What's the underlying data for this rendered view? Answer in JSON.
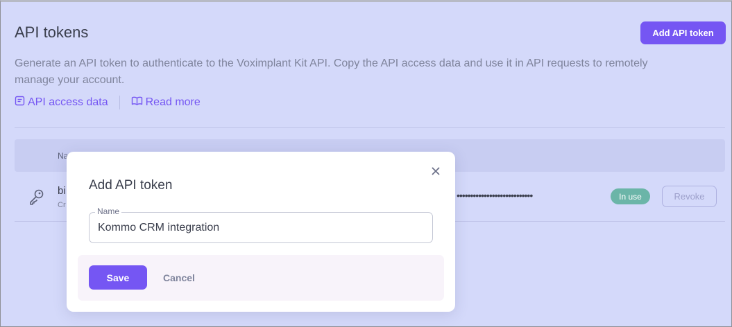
{
  "page": {
    "title": "API tokens",
    "add_button_label": "Add API token",
    "description": "Generate an API token to authenticate to the Voximplant Kit API. Copy the API access data and use it in API requests to remotely manage your account.",
    "links": [
      {
        "label": "API access data",
        "icon": "document-icon"
      },
      {
        "label": "Read more",
        "icon": "book-icon"
      }
    ]
  },
  "table": {
    "header_name": "Na",
    "row": {
      "name": "bi",
      "sub": "Cr",
      "masked_token": "••••••••••••••••••••••••••••",
      "status": "In use",
      "revoke_label": "Revoke",
      "icon": "key-icon"
    }
  },
  "modal": {
    "title": "Add API token",
    "field_label": "Name",
    "field_value": "Kommo CRM integration",
    "save_label": "Save",
    "cancel_label": "Cancel",
    "close_icon": "close-icon"
  },
  "colors": {
    "background": "#d4d9fa",
    "accent": "#7556f3",
    "status_green": "#6bb5a8",
    "modal_footer": "#f8f3fa"
  }
}
